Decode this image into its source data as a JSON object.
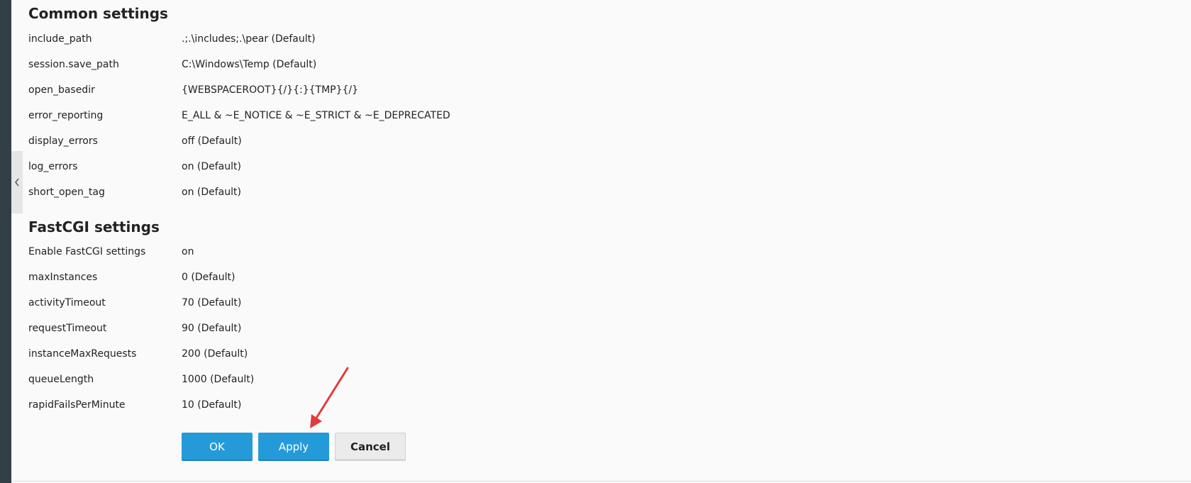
{
  "common_settings": {
    "title": "Common settings",
    "rows": [
      {
        "label": "include_path",
        "value": ".;.\\includes;.\\pear (Default)"
      },
      {
        "label": "session.save_path",
        "value": "C:\\Windows\\Temp (Default)"
      },
      {
        "label": "open_basedir",
        "value": "{WEBSPACEROOT}{/}{:}{TMP}{/}"
      },
      {
        "label": "error_reporting",
        "value": "E_ALL & ~E_NOTICE & ~E_STRICT & ~E_DEPRECATED"
      },
      {
        "label": "display_errors",
        "value": "off (Default)"
      },
      {
        "label": "log_errors",
        "value": "on (Default)"
      },
      {
        "label": "short_open_tag",
        "value": "on (Default)"
      }
    ]
  },
  "fastcgi_settings": {
    "title": "FastCGI settings",
    "rows": [
      {
        "label": "Enable FastCGI settings",
        "value": "on"
      },
      {
        "label": "maxInstances",
        "value": "0 (Default)"
      },
      {
        "label": "activityTimeout",
        "value": "70 (Default)"
      },
      {
        "label": "requestTimeout",
        "value": "90 (Default)"
      },
      {
        "label": "instanceMaxRequests",
        "value": "200 (Default)"
      },
      {
        "label": "queueLength",
        "value": "1000 (Default)"
      },
      {
        "label": "rapidFailsPerMinute",
        "value": "10 (Default)"
      }
    ]
  },
  "buttons": {
    "ok": "OK",
    "apply": "Apply",
    "cancel": "Cancel"
  },
  "icons": {
    "collapse": "chevron-left-icon",
    "annotation": "red-arrow-annotation"
  },
  "colors": {
    "primary_button": "#259ad9",
    "secondary_button": "#ebebeb",
    "sidebar_dark": "#333f47",
    "annotation_arrow": "#e23b3b",
    "text": "#222222"
  }
}
